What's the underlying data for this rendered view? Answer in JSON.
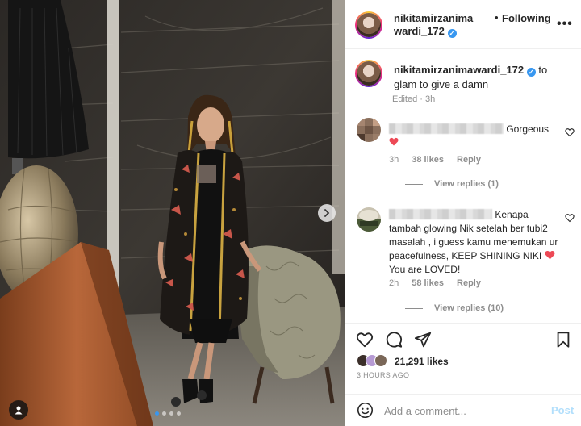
{
  "post": {
    "username": "nikitamirzanimawardi_172",
    "username_line1": "nikitamirzanima",
    "username_line2": "wardi_172",
    "verified_icon": "verified-badge-icon",
    "follow_status": "Following",
    "bullet": "•",
    "more_label": "•••"
  },
  "caption": {
    "username": "nikitamirzanimawardi_172",
    "text": "to glam to give a damn",
    "edited": "Edited · 3h"
  },
  "comments": [
    {
      "text_after": "Gorgeous",
      "time": "3h",
      "likes": "38 likes",
      "reply_label": "Reply",
      "view_replies": "View replies (1)"
    },
    {
      "text_after": "Kenapa tambah glowing Nik setelah ber tubi2 masalah , i guess kamu menemukan ur peacefulness, KEEP SHINING NIKI",
      "text_tail": "You are LOVED!",
      "time": "2h",
      "likes": "58 likes",
      "reply_label": "Reply",
      "view_replies": "View replies (10)"
    }
  ],
  "actions": {
    "icons": [
      "heart-icon",
      "comment-icon",
      "share-icon",
      "save-icon"
    ],
    "likes_count": "21,291 likes",
    "time_ago": "3 HOURS AGO"
  },
  "add_comment": {
    "placeholder": "Add a comment...",
    "post_label": "Post"
  },
  "colors": {
    "accent_blue": "#3897f0",
    "post_disabled": "#b2dffc",
    "muted": "#8e8e8e",
    "heart_red": "#ed4956"
  },
  "carousel": {
    "slide_count": 4,
    "active_index": 0
  }
}
